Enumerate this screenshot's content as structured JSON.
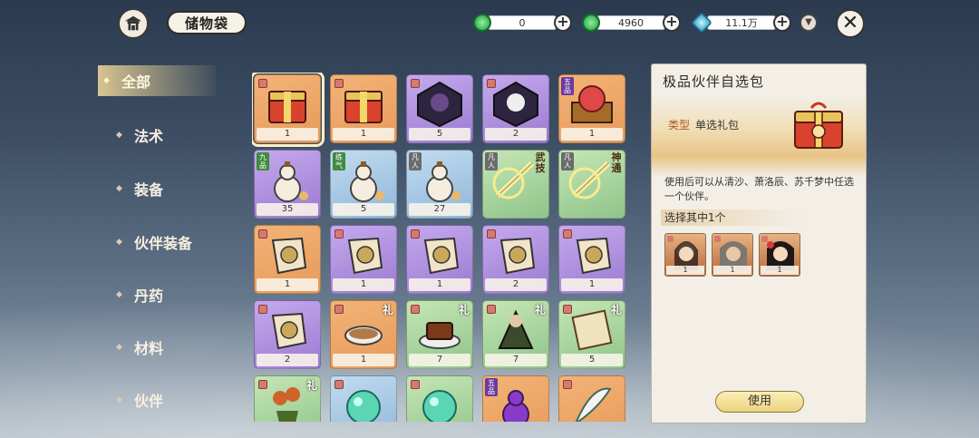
{
  "header": {
    "title": "储物袋",
    "currencies": [
      {
        "icon": "jade-coin-icon",
        "value": "0",
        "color": "#3cbf5a"
      },
      {
        "icon": "locked-jade-coin-icon",
        "value": "4960",
        "color": "#3cbf5a"
      },
      {
        "icon": "spirit-crystal-icon",
        "value": "11.1万",
        "color": "#3fb7d6"
      }
    ]
  },
  "sidebar": {
    "items": [
      {
        "label": "全部",
        "active": true
      },
      {
        "label": "法术",
        "active": false
      },
      {
        "label": "装备",
        "active": false
      },
      {
        "label": "伙伴装备",
        "active": false
      },
      {
        "label": "丹药",
        "active": false
      },
      {
        "label": "材料",
        "active": false
      },
      {
        "label": "伙伴",
        "active": false
      }
    ]
  },
  "grid": {
    "items": [
      {
        "name": "gift-chest",
        "bg": "orange",
        "count": "1",
        "selected": true
      },
      {
        "name": "gift-chest-2",
        "bg": "orange",
        "count": "1"
      },
      {
        "name": "companion-shard-dark",
        "bg": "purple",
        "count": "5"
      },
      {
        "name": "companion-shard-white",
        "bg": "purple",
        "count": "2"
      },
      {
        "name": "red-orb-box",
        "bg": "orange",
        "count": "1",
        "badge": "五品",
        "badge_color": "#6b3aa0"
      },
      {
        "name": "gourd-potion",
        "bg": "purple",
        "count": "35",
        "badge": "九品",
        "badge_color": "#3f8a3f"
      },
      {
        "name": "gourd-potion",
        "bg": "blue",
        "count": "5",
        "badge": "练气",
        "badge_color": "#3f8a3f"
      },
      {
        "name": "gourd-potion",
        "bg": "blue",
        "count": "27",
        "badge": "凡人",
        "badge_color": "#6b6b6b"
      },
      {
        "name": "martial-skill-book",
        "bg": "green",
        "count": "",
        "badge": "凡人",
        "badge_color": "#6b6b6b",
        "tag": "武技"
      },
      {
        "name": "divine-skill-book",
        "bg": "green",
        "count": "",
        "badge": "凡人",
        "badge_color": "#6b6b6b",
        "tag": "神通"
      },
      {
        "name": "equipment-fragment",
        "bg": "orange",
        "count": "1"
      },
      {
        "name": "equipment-fragment",
        "bg": "purple",
        "count": "1"
      },
      {
        "name": "equipment-fragment",
        "bg": "purple",
        "count": "1"
      },
      {
        "name": "equipment-fragment",
        "bg": "purple",
        "count": "2"
      },
      {
        "name": "equipment-fragment",
        "bg": "purple",
        "count": "1"
      },
      {
        "name": "equipment-fragment",
        "bg": "purple",
        "count": "2"
      },
      {
        "name": "soup-bowl",
        "bg": "orange",
        "count": "1",
        "gift": "礼"
      },
      {
        "name": "roast-meat",
        "bg": "green",
        "count": "7",
        "gift": "礼"
      },
      {
        "name": "robe-figure",
        "bg": "green",
        "count": "7",
        "gift": "礼"
      },
      {
        "name": "scroll-painting",
        "bg": "green",
        "count": "5",
        "gift": "礼"
      },
      {
        "name": "flower-pot",
        "bg": "green",
        "count": "",
        "gift": "礼"
      },
      {
        "name": "jade-bead",
        "bg": "blue",
        "count": ""
      },
      {
        "name": "jade-bead",
        "bg": "green",
        "count": ""
      },
      {
        "name": "purple-gourd",
        "bg": "orange",
        "count": "",
        "badge": "五品",
        "badge_color": "#6b3aa0"
      },
      {
        "name": "feather-fan",
        "bg": "orange",
        "count": ""
      }
    ]
  },
  "detail": {
    "title": "极品伙伴自选包",
    "type_key": "类型",
    "type_value": "单选礼包",
    "description": "使用后可以从清沙、萧洛辰、苏千梦中任选一个伙伴。",
    "choose_label": "选择其中1个",
    "choices": [
      {
        "name": "qing-sha-portrait",
        "count": "1"
      },
      {
        "name": "xiao-luo-chen-portrait",
        "count": "1"
      },
      {
        "name": "su-qian-meng-portrait",
        "count": "1"
      }
    ],
    "use_label": "使用"
  },
  "colors": {
    "orange": "#e69a5a",
    "purple": "#9c7ad0",
    "blue": "#8fb6d8",
    "green": "#8fc48a"
  }
}
